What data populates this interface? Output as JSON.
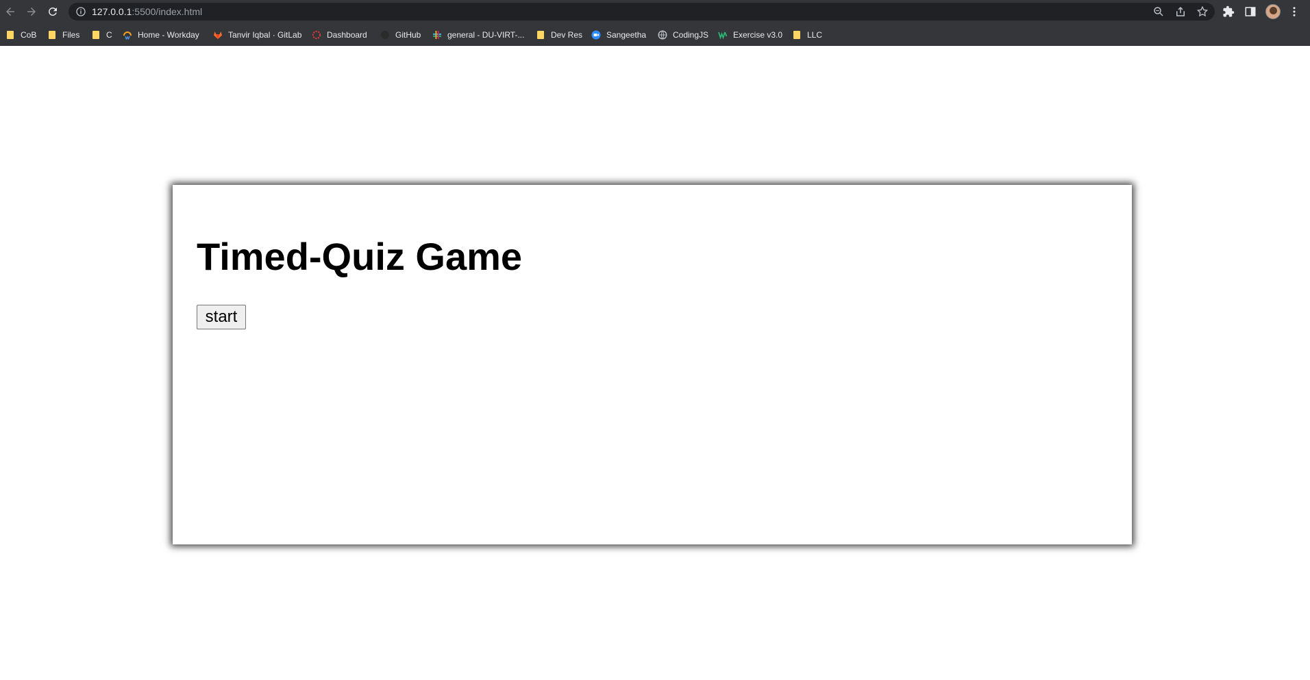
{
  "browser": {
    "url_host": "127.0.0.1",
    "url_rest": ":5500/index.html",
    "bookmarks": [
      {
        "label": "CoB",
        "icon": "folder-icon"
      },
      {
        "label": "Files",
        "icon": "folder-icon"
      },
      {
        "label": "C",
        "icon": "folder-icon"
      },
      {
        "label": "Home - Workday",
        "icon": "workday-icon"
      },
      {
        "label": "Tanvir Iqbal · GitLab",
        "icon": "gitlab-icon"
      },
      {
        "label": "Dashboard",
        "icon": "dashboard-icon"
      },
      {
        "label": "GitHub",
        "icon": "github-icon"
      },
      {
        "label": "general - DU-VIRT-...",
        "icon": "slack-icon"
      },
      {
        "label": "Dev Res",
        "icon": "folder-icon"
      },
      {
        "label": "Sangeetha",
        "icon": "zoom-icon"
      },
      {
        "label": "CodingJS",
        "icon": "globe-icon"
      },
      {
        "label": "Exercise v3.0",
        "icon": "w-icon"
      },
      {
        "label": "LLC",
        "icon": "folder-icon"
      }
    ],
    "colors": {
      "toolbar": "#35363a",
      "omnibox": "#202124",
      "folder": "#fdd663"
    }
  },
  "page": {
    "title": "Timed-Quiz Game",
    "start_label": "start"
  }
}
